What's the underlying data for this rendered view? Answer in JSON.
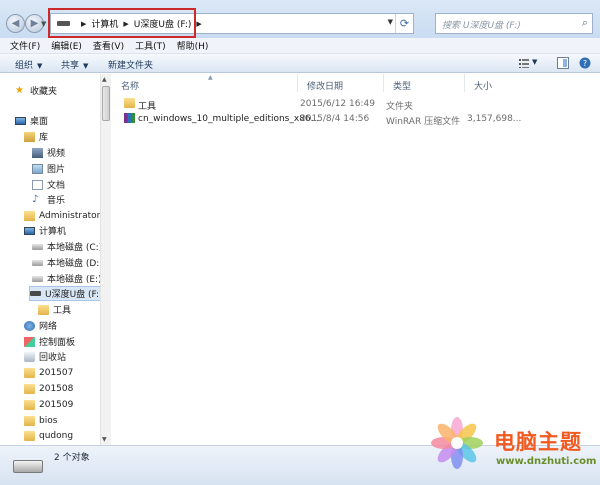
{
  "address": {
    "crumbs": [
      "计算机",
      "U深度U盘 (F:)"
    ],
    "search_placeholder": "搜索 U深度U盘 (F:)"
  },
  "menu": [
    "文件(F)",
    "编辑(E)",
    "查看(V)",
    "工具(T)",
    "帮助(H)"
  ],
  "toolbar": {
    "organize": "组织",
    "share": "共享",
    "new_folder": "新建文件夹"
  },
  "nav": {
    "favorites": "收藏夹",
    "desktop": "桌面",
    "libraries": "库",
    "lib_video": "视频",
    "lib_pictures": "图片",
    "lib_docs": "文档",
    "lib_music": "音乐",
    "admin": "Administrator",
    "computer": "计算机",
    "disk_c": "本地磁盘 (C:)",
    "disk_d": "本地磁盘 (D:)",
    "disk_e": "本地磁盘 (E:)",
    "usb_f": "U深度U盘 (F:)",
    "usb_tools": "工具",
    "network": "网络",
    "control_panel": "控制面板",
    "recycle": "回收站",
    "f201507": "201507",
    "f201508": "201508",
    "f201509": "201509",
    "bios": "bios",
    "qudong": "qudong"
  },
  "columns": {
    "name": "名称",
    "date": "修改日期",
    "type": "类型",
    "size": "大小"
  },
  "files": [
    {
      "name": "工具",
      "date": "2015/6/12 16:49",
      "type": "文件夹",
      "size": "",
      "icon": "folder-icon"
    },
    {
      "name": "cn_windows_10_multiple_editions_x86...",
      "date": "2015/8/4 14:56",
      "type": "WinRAR 压缩文件",
      "size": "3,157,698...",
      "icon": "winrar-icon"
    }
  ],
  "status": {
    "count": "2 个对象"
  },
  "watermark": {
    "title": "电脑主题",
    "url": "www.dnzhuti.com"
  },
  "colors": {
    "highlight_box": "#cc2a2a",
    "watermark_title": "#f05a21",
    "watermark_url": "#6b8e2a"
  }
}
